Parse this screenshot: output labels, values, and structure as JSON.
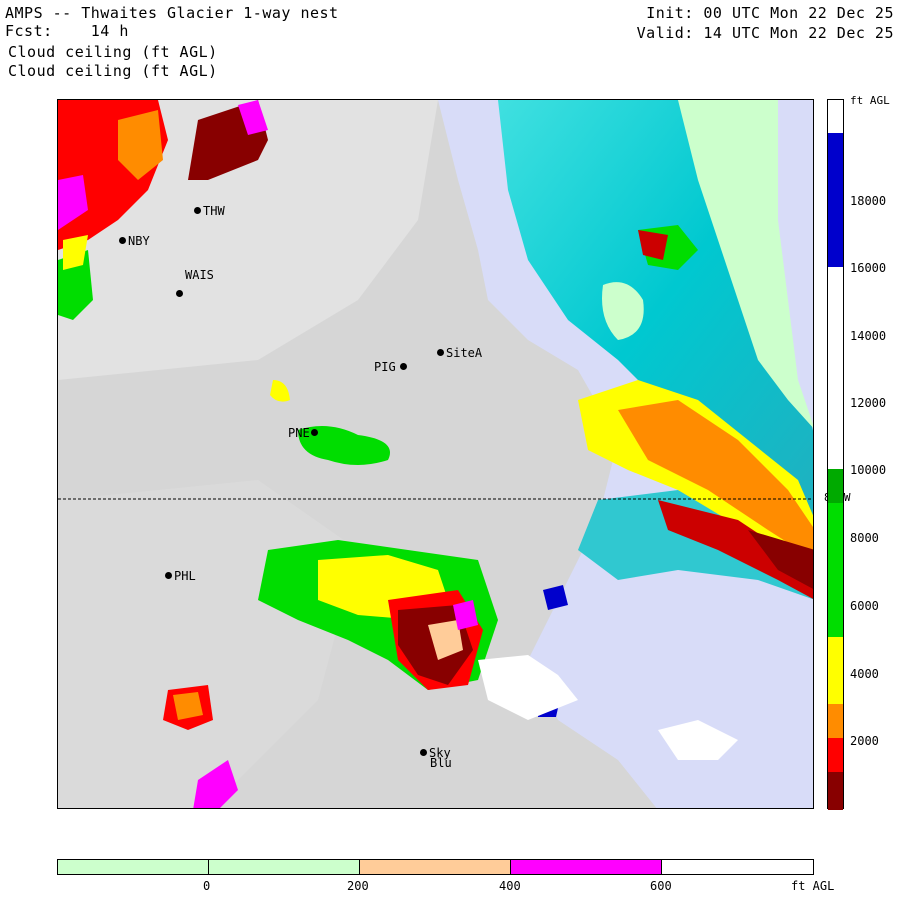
{
  "header": {
    "title": "AMPS -- Thwaites Glacier 1-way nest",
    "forecast": "Fcst:    14 h",
    "field1": "Cloud ceiling (ft AGL)",
    "field2": "Cloud ceiling (ft AGL)",
    "init": "Init: 00 UTC Mon 22 Dec 25",
    "valid": "Valid: 14 UTC Mon 22 Dec 25"
  },
  "map": {
    "latitude_label": "80 W",
    "stations": [
      {
        "id": "THW",
        "label": "THW"
      },
      {
        "id": "NBY",
        "label": "NBY"
      },
      {
        "id": "WAIS",
        "label": "WAIS"
      },
      {
        "id": "PIG",
        "label": "PIG"
      },
      {
        "id": "SiteA",
        "label": "SiteA"
      },
      {
        "id": "PNE",
        "label": "PNE"
      },
      {
        "id": "PHL",
        "label": "PHL"
      },
      {
        "id": "Sky",
        "label": "Sky"
      },
      {
        "id": "Blu",
        "label": "Blu"
      }
    ]
  },
  "colorbar": {
    "unit": "ft AGL",
    "labels": [
      "18000",
      "16000",
      "14000",
      "12000",
      "10000",
      "8000",
      "6000",
      "4000",
      "2000"
    ],
    "colors": [
      "#ffffff",
      "#0000cc",
      "#ffffff",
      "#ffffff",
      "#00aa00",
      "#00dd00",
      "#ffff00",
      "#ff8c00",
      "#ff0000",
      "#880000"
    ]
  },
  "hbar": {
    "unit": "ft AGL",
    "labels": [
      "0",
      "200",
      "400",
      "600"
    ],
    "colors": [
      "#ccffcc",
      "#ccffcc",
      "#ffcc99",
      "#ff00ff",
      "#ffffff"
    ]
  }
}
